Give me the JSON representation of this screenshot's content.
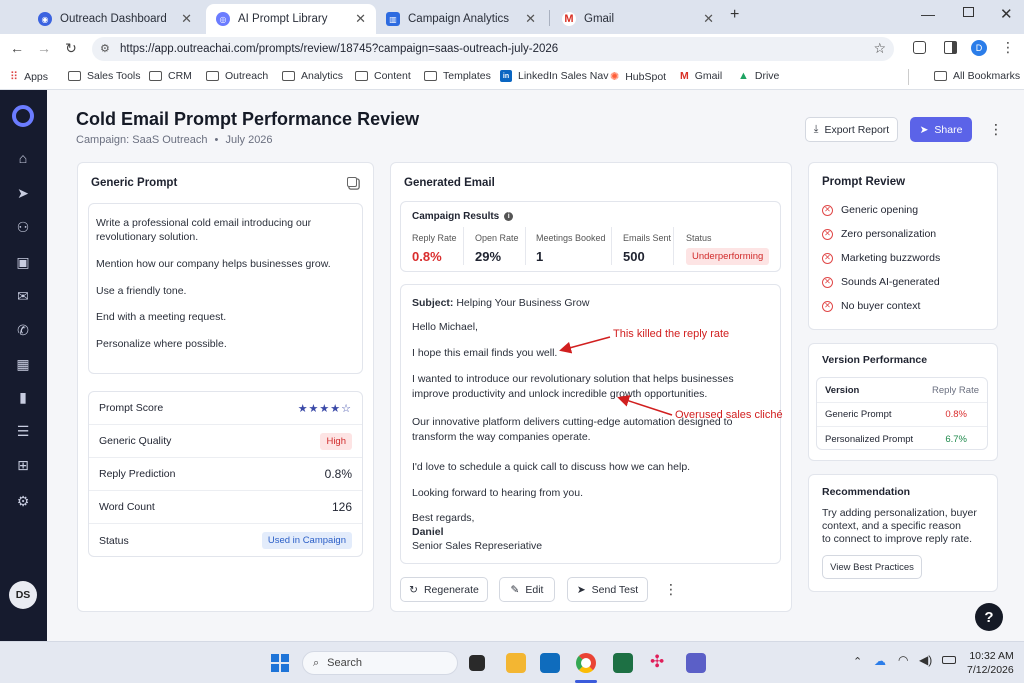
{
  "browser": {
    "tabs": [
      {
        "label": "Outreach Dashboard"
      },
      {
        "label": "AI Prompt Library"
      },
      {
        "label": "Campaign Analytics"
      },
      {
        "label": "Gmail"
      }
    ],
    "url": "https://app.outreachai.com/prompts/review/18745?campaign=saas-outreach-july-2026",
    "profile_initial": "D",
    "bookmarks": [
      "Apps",
      "Sales Tools",
      "CRM",
      "Outreach",
      "Analytics",
      "Content",
      "Templates",
      "LinkedIn Sales Nav",
      "HubSpot",
      "Gmail",
      "Drive"
    ],
    "all_bookmarks": "All Bookmarks"
  },
  "sidebar": {
    "user_initials": "DS"
  },
  "header": {
    "title": "Cold Email Prompt Performance Review",
    "campaign": "Campaign: SaaS Outreach",
    "date": "July 2026",
    "export_label": "Export Report",
    "share_label": "Share"
  },
  "prompt": {
    "title": "Generic Prompt",
    "lines": [
      "Write a professional cold email introducing our",
      "revolutionary solution.",
      "Mention how our company helps businesses grow.",
      "Use a friendly tone.",
      "End with a meeting request.",
      "Personalize where possible."
    ],
    "stats": {
      "score_label": "Prompt Score",
      "rating": 4,
      "max_rating": 5,
      "quality_label": "Generic Quality",
      "quality_value": "High",
      "reply_label": "Reply Prediction",
      "reply_value": "0.8%",
      "word_label": "Word Count",
      "word_value": "126",
      "status_label": "Status",
      "status_value": "Used in Campaign"
    }
  },
  "email": {
    "title": "Generated Email",
    "results_title": "Campaign Results",
    "metrics": [
      {
        "label": "Reply Rate",
        "value": "0.8%"
      },
      {
        "label": "Open Rate",
        "value": "29%"
      },
      {
        "label": "Meetings Booked",
        "value": "1"
      },
      {
        "label": "Emails Sent",
        "value": "500"
      },
      {
        "label": "Status",
        "value": "Underperforming"
      }
    ],
    "subject_label": "Subject:",
    "subject": "Helping Your Business Grow",
    "greeting": "Hello Michael,",
    "line1": "I hope this email finds you well.",
    "p2a": "I wanted to introduce our revolutionary solution that helps businesses",
    "p2b": "improve productivity and unlock incredible growth opportunities.",
    "p3a": "Our innovative platform delivers cutting-edge automation designed to",
    "p3b": "transform the way companies operate.",
    "p4": "I'd love to schedule a quick call to discuss how we can help.",
    "p5": "Looking forward to hearing from you.",
    "signoff": "Best regards,",
    "name": "Daniel",
    "role": "Senior Sales Represeriative",
    "annotation1": "This killed the reply rate",
    "annotation2": "Overused sales cliché",
    "regenerate_label": "Regenerate",
    "edit_label": "Edit",
    "send_test_label": "Send Test"
  },
  "review": {
    "title": "Prompt Review",
    "items": [
      "Generic opening",
      "Zero personalization",
      "Marketing buzzwords",
      "Sounds AI-generated",
      "No buyer context"
    ]
  },
  "versions": {
    "title": "Version Performance",
    "col1": "Version",
    "col2": "Reply Rate",
    "rows": [
      {
        "name": "Generic Prompt",
        "rate": "0.8%"
      },
      {
        "name": "Personalized Prompt",
        "rate": "6.7%"
      }
    ]
  },
  "recommendation": {
    "title": "Recommendation",
    "lines": [
      "Try adding personalization, buyer",
      "context, and a specific reason",
      "to connect to improve reply rate."
    ],
    "button": "View Best Practices"
  },
  "taskbar": {
    "search_placeholder": "Search",
    "time": "10:32 AM",
    "date": "7/12/2026"
  },
  "colors": {
    "accent": "#5b63e8",
    "sidebar": "#161b2e",
    "danger": "#d92d2d",
    "success": "#1f8a4c"
  }
}
